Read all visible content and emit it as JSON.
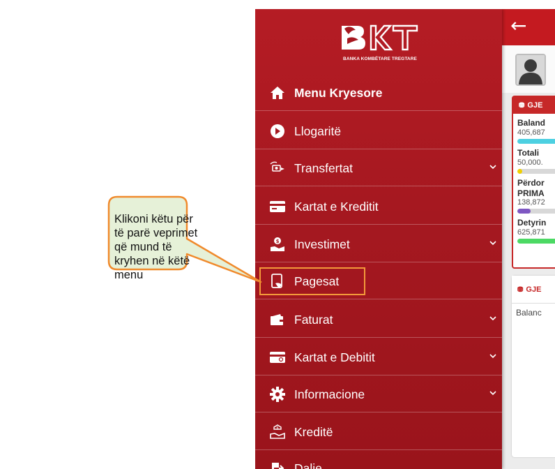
{
  "app": {
    "brand": "BKT",
    "brand_subtitle": "BANKA KOMBËTARE TREGTARE",
    "accent_color": "#c41a20",
    "highlight_color": "#f39a3a"
  },
  "menu": {
    "items": [
      {
        "label": "Menu Kryesore",
        "icon": "home-icon",
        "expandable": false,
        "bold": true
      },
      {
        "label": "Llogaritë",
        "icon": "accounts-icon",
        "expandable": false
      },
      {
        "label": "Transfertat",
        "icon": "transfer-icon",
        "expandable": true
      },
      {
        "label": "Kartat e Kreditit",
        "icon": "credit-card-icon",
        "expandable": false
      },
      {
        "label": "Investimet",
        "icon": "investment-icon",
        "expandable": true
      },
      {
        "label": "Pagesat",
        "icon": "payments-icon",
        "expandable": false,
        "highlighted": true
      },
      {
        "label": "Faturat",
        "icon": "wallet-icon",
        "expandable": true
      },
      {
        "label": "Kartat e Debitit",
        "icon": "debit-card-icon",
        "expandable": true
      },
      {
        "label": "Informacione",
        "icon": "gear-icon",
        "expandable": true
      },
      {
        "label": "Kreditë",
        "icon": "loan-icon",
        "expandable": false
      },
      {
        "label": "Dalie",
        "icon": "logout-icon",
        "expandable": false
      }
    ]
  },
  "main": {
    "back_icon": "back-arrow-icon",
    "card1": {
      "header": "GJE",
      "stats": [
        {
          "label": "Baland",
          "value": "405,687",
          "fill_fraction": 1.0,
          "color": "#4dd0e1"
        },
        {
          "label": "Totali",
          "value": "50,000.",
          "fill_fraction": 0.12,
          "color": "#f0d000"
        },
        {
          "label": "Përdor",
          "sub": "PRIMA",
          "value": "138,872",
          "fill_fraction": 0.3,
          "color": "#7e57c2"
        },
        {
          "label": "Detyrin",
          "value": "625,871",
          "fill_fraction": 1.0,
          "color": "#4cd964"
        }
      ]
    },
    "card2": {
      "header": "GJE",
      "text": "Balanc"
    }
  },
  "callout": {
    "text": "Klikoni këtu për të parë veprimet që mund të kryhen në këtë menu",
    "border_color": "#f08a2c",
    "fill_color": "#e6f1d8"
  }
}
